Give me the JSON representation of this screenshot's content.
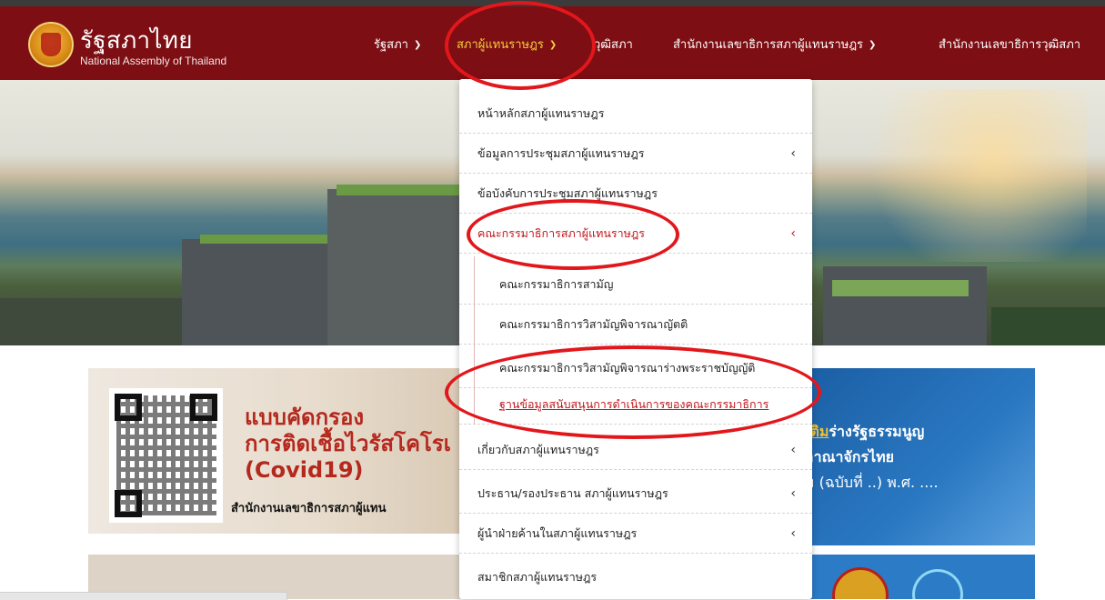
{
  "brand": {
    "title_thai": "รัฐสภาไทย",
    "title_en": "National Assembly of Thailand"
  },
  "nav": {
    "items": [
      {
        "label": "รัฐสภา",
        "chevron": "chevron-down-icon"
      },
      {
        "label": "สภาผู้แทนราษฎร",
        "chevron": "chevron-down-icon",
        "active": true
      },
      {
        "label": "วุฒิสภา"
      },
      {
        "label": "สำนักงานเลขาธิการสภาผู้แทนราษฎร",
        "chevron": "chevron-down-icon"
      },
      {
        "label": "สำนักงานเลขาธิการวุฒิสภา"
      }
    ]
  },
  "dropdown": {
    "items": [
      {
        "label": "หน้าหลักสภาผู้แทนราษฎร"
      },
      {
        "label": "ข้อมูลการประชุมสภาผู้แทนราษฎร",
        "arrow": "‹"
      },
      {
        "label": "ข้อบังคับการประชุมสภาผู้แทนราษฎร"
      },
      {
        "label": "คณะกรรมาธิการสภาผู้แทนราษฎร",
        "arrow": "‹"
      },
      {
        "label": "คณะกรรมาธิการสามัญ"
      },
      {
        "label": "คณะกรรมาธิการวิสามัญพิจารณาญัตติ"
      },
      {
        "label": "คณะกรรมาธิการวิสามัญพิจารณาร่างพระราชบัญญัติ"
      },
      {
        "label": "ฐานข้อมูลสนับสนุนการดำเนินการของคณะกรรมาธิการ"
      },
      {
        "label": "เกี่ยวกับสภาผู้แทนราษฎร",
        "arrow": "‹"
      },
      {
        "label": "ประธาน/รองประธาน สภาผู้แทนราษฎร",
        "arrow": "‹"
      },
      {
        "label": "ผู้นำฝ่ายค้านในสภาผู้แทนราษฎร",
        "arrow": "‹"
      },
      {
        "label": "สมาชิกสภาผู้แทนราษฎร"
      }
    ]
  },
  "banner_left": {
    "line1": "แบบคัดกรอง",
    "line2": "การติดเชื้อไวรัสโคโรเ",
    "line3": "(Covid19)",
    "footer": "สำนักงานเลขาธิการสภาผู้แทน"
  },
  "banner_right": {
    "l1_gold": "เติม",
    "l1_rest": "ร่างรัฐธรรมนูญ",
    "l2": "อาณาจักรไทย",
    "l3": "ม (ฉบับที่ ..) พ.ศ. ...."
  },
  "colors": {
    "header": "#7d0e13",
    "active_nav": "#f6d03c",
    "highlight_red": "#c0161b",
    "annotation_red": "#e2171c"
  }
}
